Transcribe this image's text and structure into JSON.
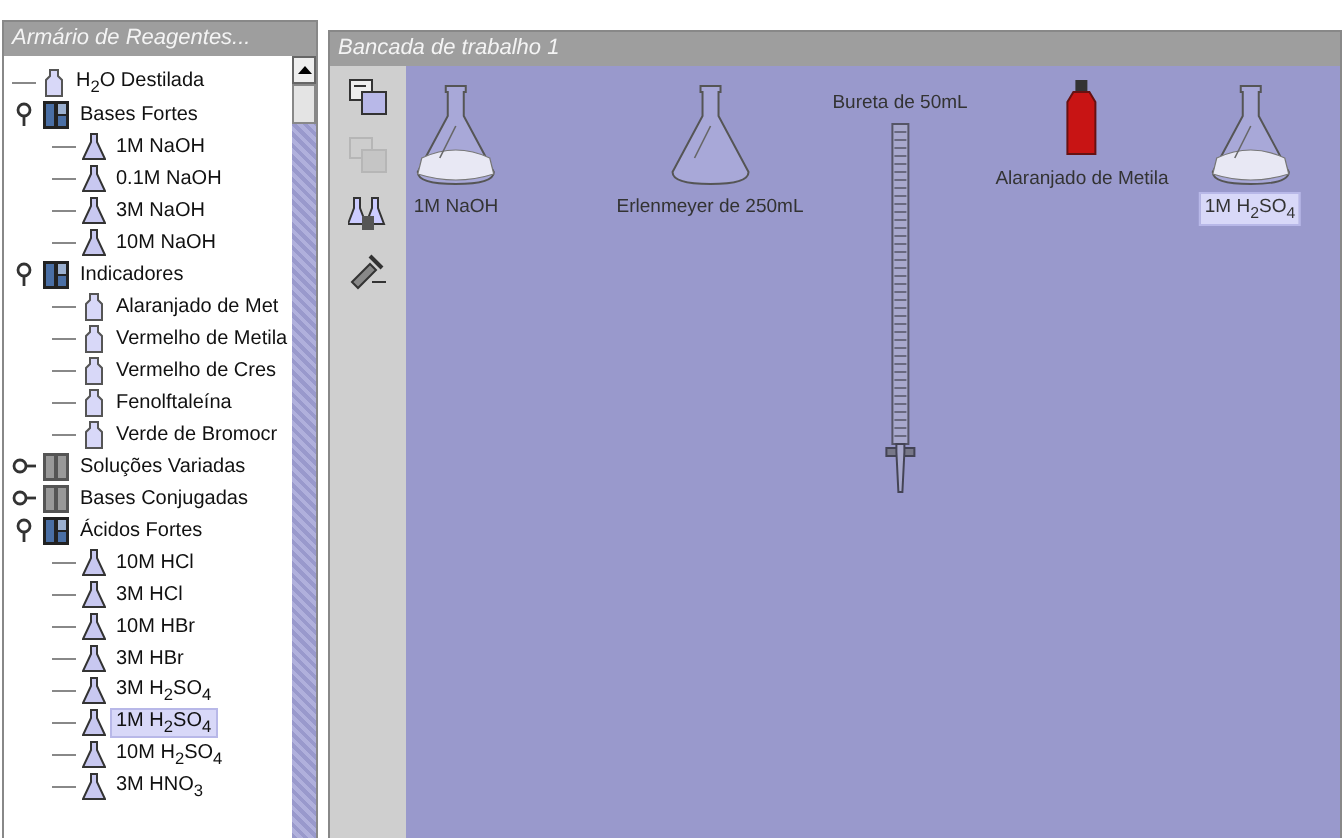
{
  "reagent_panel": {
    "title": "Armário de Reagentes...",
    "tree": [
      {
        "kind": "bottle",
        "label": "H$_{2}$O Destilada",
        "selected": false
      },
      {
        "kind": "folder",
        "label": "Bases Fortes",
        "expanded": true,
        "selected": false,
        "children": [
          {
            "kind": "flask",
            "label": "1M NaOH",
            "selected": false
          },
          {
            "kind": "flask",
            "label": "0.1M NaOH",
            "selected": false
          },
          {
            "kind": "flask",
            "label": "3M NaOH",
            "selected": false
          },
          {
            "kind": "flask",
            "label": "10M NaOH",
            "selected": false
          }
        ]
      },
      {
        "kind": "folder",
        "label": "Indicadores",
        "expanded": true,
        "selected": false,
        "children": [
          {
            "kind": "bottle",
            "label": "Alaranjado de Met",
            "selected": false
          },
          {
            "kind": "bottle",
            "label": "Vermelho de Metila",
            "selected": false
          },
          {
            "kind": "bottle",
            "label": "Vermelho de Cres",
            "selected": false
          },
          {
            "kind": "bottle",
            "label": "Fenolftaleína",
            "selected": false
          },
          {
            "kind": "bottle",
            "label": "Verde de Bromocr",
            "selected": false
          }
        ]
      },
      {
        "kind": "folder",
        "label": "Soluções Variadas",
        "expanded": false,
        "selected": false
      },
      {
        "kind": "folder",
        "label": "Bases Conjugadas",
        "expanded": false,
        "selected": false
      },
      {
        "kind": "folder",
        "label": "Ácidos Fortes",
        "expanded": true,
        "selected": false,
        "children": [
          {
            "kind": "flask",
            "label": "10M HCl",
            "selected": false
          },
          {
            "kind": "flask",
            "label": "3M HCl",
            "selected": false
          },
          {
            "kind": "flask",
            "label": "10M HBr",
            "selected": false
          },
          {
            "kind": "flask",
            "label": "3M HBr",
            "selected": false
          },
          {
            "kind": "flask",
            "label": "3M H$_{2}$SO$_{4}$",
            "selected": false
          },
          {
            "kind": "flask",
            "label": "1M H$_{2}$SO$_{4}$",
            "selected": true
          },
          {
            "kind": "flask",
            "label": "10M H$_{2}$SO$_{4}$",
            "selected": false
          },
          {
            "kind": "flask",
            "label": "3M HNO$_{3}$",
            "selected": false
          }
        ]
      }
    ]
  },
  "workbench": {
    "title": "Bancada de trabalho 1",
    "toolbar": [
      {
        "kind": "copy",
        "disabled": false
      },
      {
        "kind": "paste",
        "disabled": true
      },
      {
        "kind": "glassware",
        "disabled": false
      },
      {
        "kind": "tools",
        "disabled": false
      }
    ],
    "items": [
      {
        "kind": "flask",
        "label": "1M NaOH",
        "filled": true,
        "selected": false
      },
      {
        "kind": "flask",
        "label": "Erlenmeyer de 250mL",
        "filled": false,
        "selected": false
      },
      {
        "kind": "burette",
        "label": "Bureta de 50mL",
        "selected": false
      },
      {
        "kind": "bottle",
        "label": "Alaranjado de Metila",
        "selected": false
      },
      {
        "kind": "flask",
        "label": "1M H$_{2}$SO$_{4}$",
        "filled": true,
        "selected": true
      }
    ]
  }
}
